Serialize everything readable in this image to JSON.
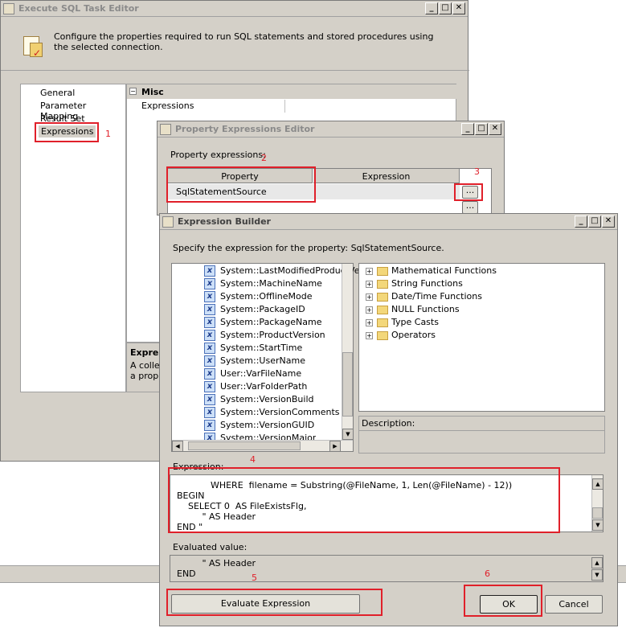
{
  "sql_editor": {
    "title": "Execute SQL Task Editor",
    "description": "Configure the properties required to run SQL statements and stored procedures using the selected connection.",
    "nav": [
      "General",
      "Parameter Mapping",
      "Result Set",
      "Expressions"
    ],
    "misc_header": "Misc",
    "misc_row": "Expressions",
    "desc_title": "Expre",
    "desc_line1": "A colle",
    "desc_line2": "a prop"
  },
  "prop_editor": {
    "title": "Property Expressions Editor",
    "label": "Property expressions:",
    "col_property": "Property",
    "col_expression": "Expression",
    "row_property": "SqlStatementSource",
    "ellipsis": "..."
  },
  "expr_builder": {
    "title": "Expression Builder",
    "prompt": "Specify the expression for the property: SqlStatementSource.",
    "variables": [
      "System::LastModifiedProductVe",
      "System::MachineName",
      "System::OfflineMode",
      "System::PackageID",
      "System::PackageName",
      "System::ProductVersion",
      "System::StartTime",
      "System::UserName",
      "User::VarFileName",
      "User::VarFolderPath",
      "System::VersionBuild",
      "System::VersionComments",
      "System::VersionGUID",
      "System::VersionMajor"
    ],
    "functions": [
      "Mathematical Functions",
      "String Functions",
      "Date/Time Functions",
      "NULL Functions",
      "Type Casts",
      "Operators"
    ],
    "description_label": "Description:",
    "expression_label": "Expression:",
    "expression_text": "            WHERE  filename = Substring(@FileName, 1, Len(@FileName) - 12))\nBEGIN\n    SELECT 0  AS FileExistsFlg,\n         \" AS Header\nEND \"",
    "evaluated_label": "Evaluated value:",
    "evaluated_text": "         \" AS Header\nEND",
    "evaluate_button": "Evaluate Expression",
    "ok_button": "OK",
    "cancel_button": "Cancel"
  },
  "annotations": [
    "1",
    "2",
    "3",
    "4",
    "5",
    "6"
  ],
  "colors": {
    "annotation_red": "#e0202a",
    "dialog_gray": "#d4d0c8"
  }
}
